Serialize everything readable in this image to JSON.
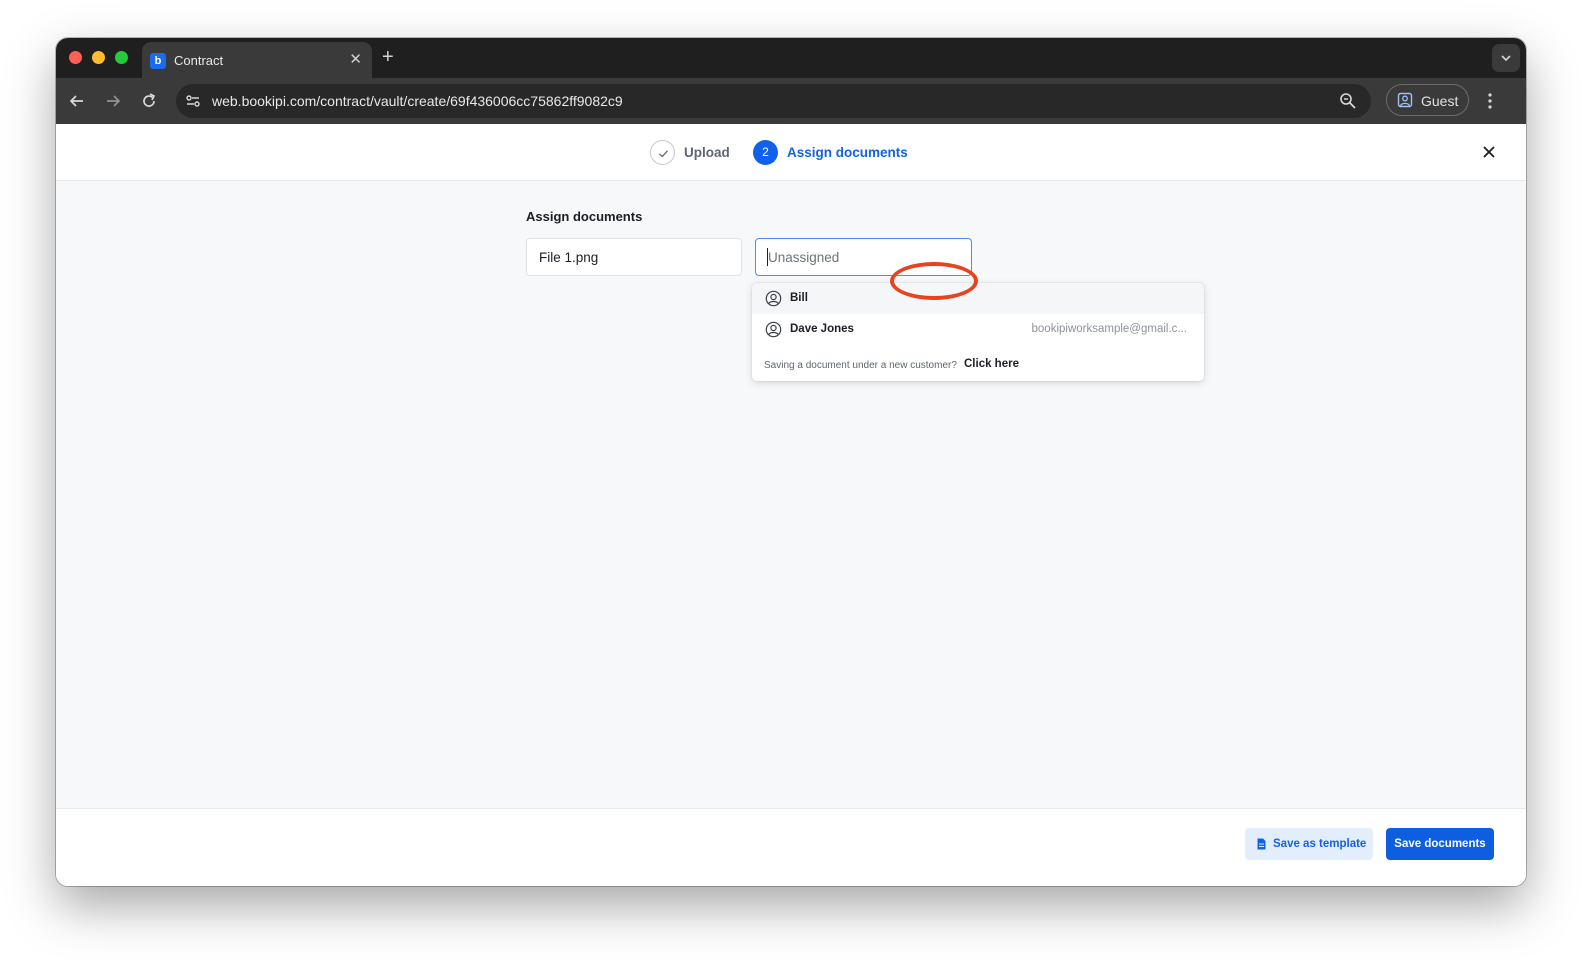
{
  "browser": {
    "tab_title": "Contract",
    "tab_favicon": "b",
    "url": "web.bookipi.com/contract/vault/create/69f436006cc75862ff9082c9",
    "profile_label": "Guest",
    "colors": {
      "close": "#ff5f57",
      "minimize": "#febc2e",
      "maximize": "#28c840"
    }
  },
  "stepper": {
    "steps": [
      {
        "label": "Upload",
        "state": "completed",
        "icon": "check-icon"
      },
      {
        "label": "Assign documents",
        "number": "2",
        "state": "active"
      }
    ],
    "accent": "#1162e8"
  },
  "main": {
    "title": "Assign documents",
    "file_name": "File 1.png",
    "assignee_input": {
      "placeholder": "Unassigned",
      "value": ""
    }
  },
  "dropdown": {
    "options": [
      {
        "name": "Bill",
        "email": "",
        "icon": "user-circle-icon"
      },
      {
        "name": "Dave Jones",
        "email": "bookipiworksample@gmail.c...",
        "icon": "user-circle-icon"
      }
    ],
    "footer_text": "Saving a document under a new customer?",
    "footer_link": "Click here",
    "annotation_color": "#e8421e"
  },
  "footer": {
    "save_template_label": "Save as template",
    "save_documents_label": "Save documents"
  }
}
